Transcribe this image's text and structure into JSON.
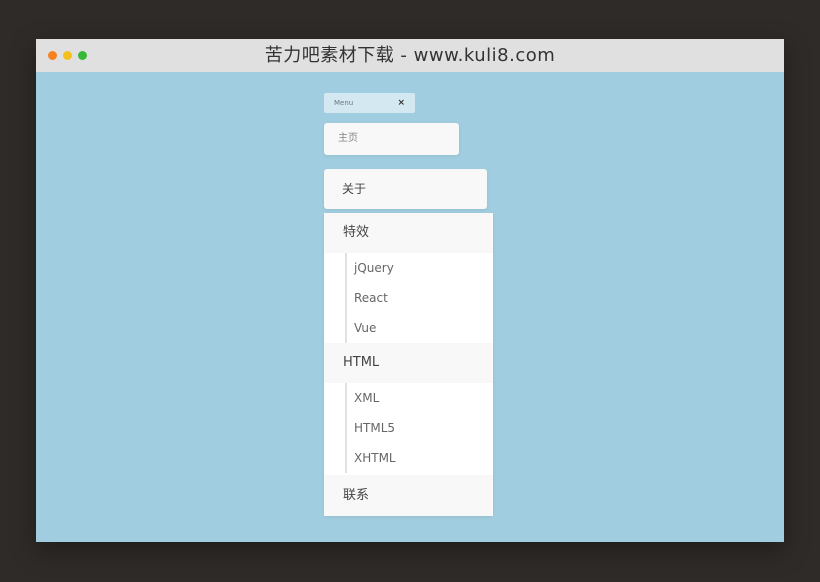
{
  "window": {
    "title": "苦力吧素材下载 - www.kuli8.com"
  },
  "menu": {
    "header_label": "Menu",
    "close_symbol": "×",
    "home": "主页",
    "about": "关于",
    "groups": [
      {
        "label": "特效",
        "items": [
          "jQuery",
          "React",
          "Vue"
        ]
      },
      {
        "label": "HTML",
        "items": [
          "XML",
          "HTML5",
          "XHTML"
        ]
      }
    ],
    "contact": "联系"
  },
  "colors": {
    "page_background": "#2f2b28",
    "content_background": "#a0cddf",
    "titlebar": "#e0e0e0",
    "dot_red": "#f5811f",
    "dot_yellow": "#f3c01b",
    "dot_green": "#36b938"
  }
}
